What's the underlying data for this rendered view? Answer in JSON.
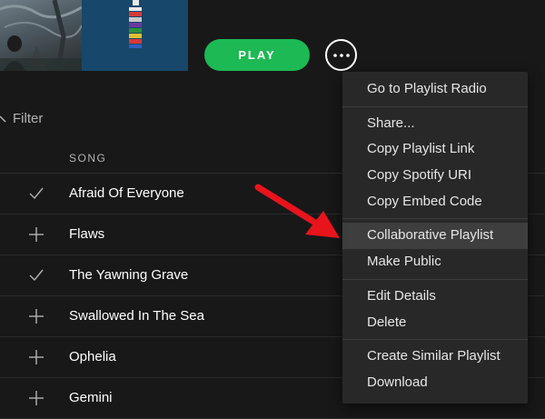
{
  "header": {
    "play_label": "PLAY"
  },
  "filter": {
    "label": "Filter"
  },
  "tracklist": {
    "column_song": "SONG",
    "tracks": [
      {
        "title": "Afraid Of Everyone",
        "saved": true
      },
      {
        "title": "Flaws",
        "saved": false
      },
      {
        "title": "The Yawning Grave",
        "saved": true
      },
      {
        "title": "Swallowed In The Sea",
        "saved": false
      },
      {
        "title": "Ophelia",
        "saved": false
      },
      {
        "title": "Gemini",
        "saved": false
      }
    ]
  },
  "context_menu": {
    "groups": [
      [
        "Go to Playlist Radio"
      ],
      [
        "Share...",
        "Copy Playlist Link",
        "Copy Spotify URI",
        "Copy Embed Code"
      ],
      [
        "Collaborative Playlist",
        "Make Public"
      ],
      [
        "Edit Details",
        "Delete"
      ],
      [
        "Create Similar Playlist",
        "Download"
      ]
    ],
    "highlighted": "Collaborative Playlist"
  },
  "colors": {
    "accent": "#1db954",
    "background": "#181818",
    "menu_bg": "#282828",
    "annotation_arrow": "#e8141c"
  },
  "icons": {
    "more": "ellipsis-icon",
    "saved": "check-icon",
    "not_saved": "plus-icon",
    "annotation": "red-arrow-icon"
  }
}
